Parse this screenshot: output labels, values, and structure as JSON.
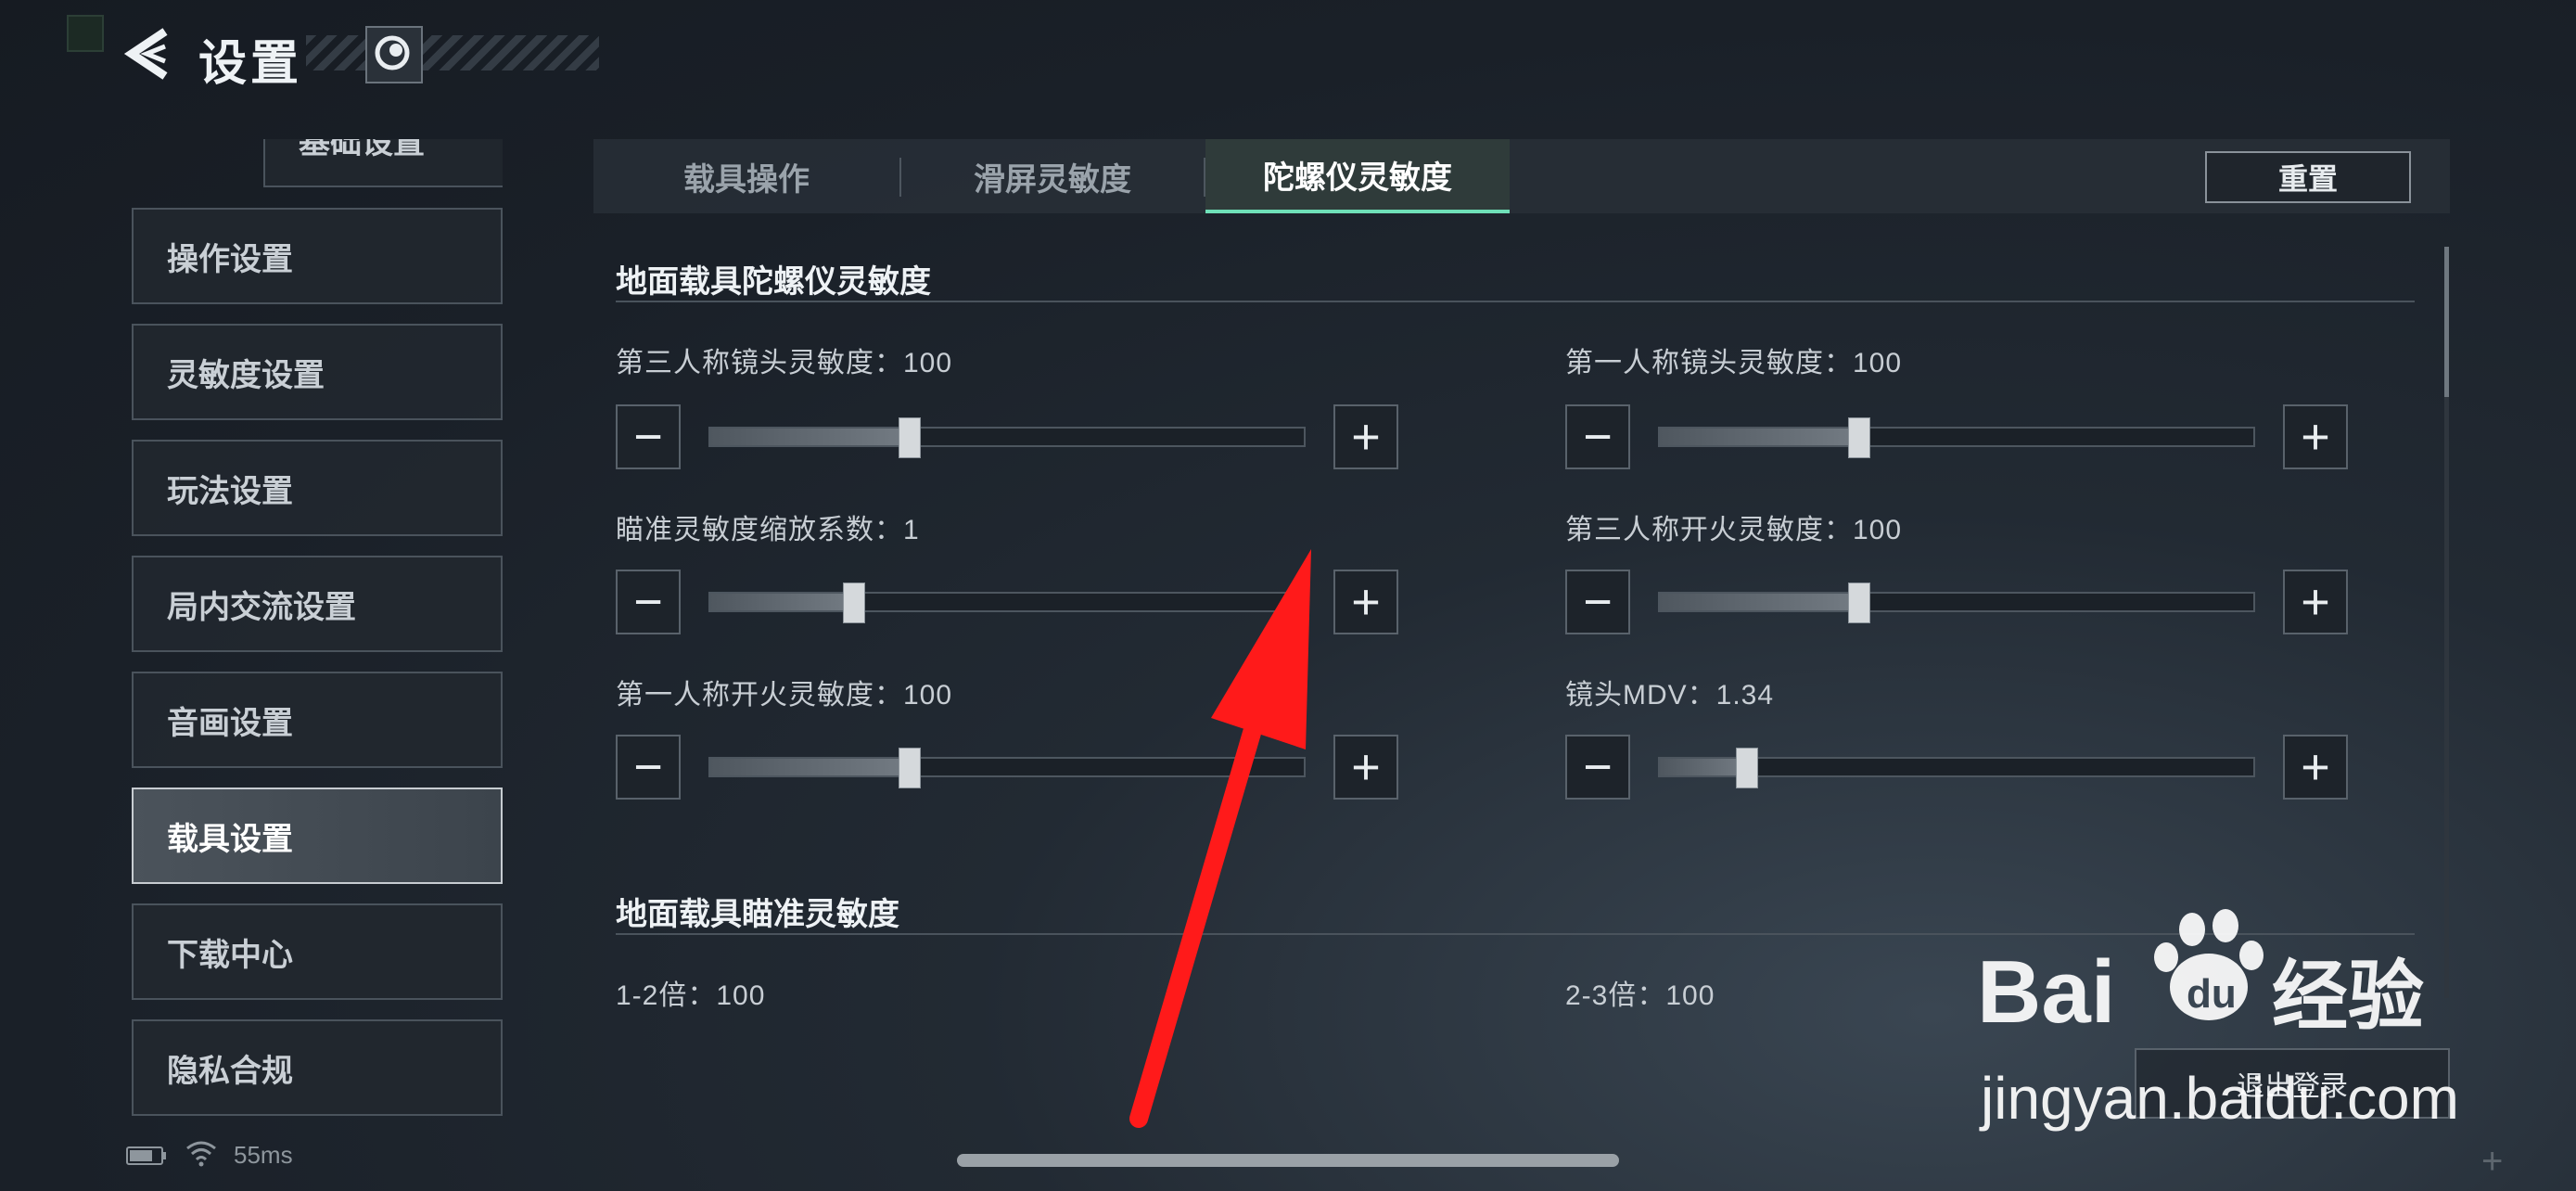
{
  "header": {
    "title": "设置",
    "back_icon": "back-arrow-icon",
    "avatar_icon": "avatar-icon"
  },
  "sidebar": {
    "items": [
      {
        "label": "基础设置",
        "active": false
      },
      {
        "label": "操作设置",
        "active": false
      },
      {
        "label": "灵敏度设置",
        "active": false
      },
      {
        "label": "玩法设置",
        "active": false
      },
      {
        "label": "局内交流设置",
        "active": false
      },
      {
        "label": "音画设置",
        "active": false
      },
      {
        "label": "载具设置",
        "active": true
      },
      {
        "label": "下载中心",
        "active": false
      },
      {
        "label": "隐私合规",
        "active": false
      }
    ]
  },
  "tabs": [
    {
      "label": "载具操作",
      "active": false
    },
    {
      "label": "滑屏灵敏度",
      "active": false
    },
    {
      "label": "陀螺仪灵敏度",
      "active": true
    }
  ],
  "reset_label": "重置",
  "sections": [
    {
      "title": "地面载具陀螺仪灵敏度",
      "settings": [
        {
          "label": "第三人称镜头灵敏度：100",
          "level": 0.335
        },
        {
          "label": "第一人称镜头灵敏度：100",
          "level": 0.335
        },
        {
          "label": "瞄准灵敏度缩放系数：1",
          "level": 0.24
        },
        {
          "label": "第三人称开火灵敏度：100",
          "level": 0.335
        },
        {
          "label": "第一人称开火灵敏度：100",
          "level": 0.335
        },
        {
          "label": "镜头MDV：1.34",
          "level": 0.145
        }
      ]
    },
    {
      "title": "地面载具瞄准灵敏度",
      "settings": [
        {
          "label": "1-2倍：100"
        },
        {
          "label": "2-3倍：100"
        }
      ]
    }
  ],
  "logout_label": "退出登录",
  "status": {
    "ping": "55ms",
    "battery_icon": "battery-icon",
    "wifi_icon": "wifi-icon"
  },
  "watermark": {
    "brand": "Bai du 经验",
    "url": "jingyan.baidu.com"
  },
  "colors": {
    "accent": "#6fe0b8",
    "arrow": "#ff1a1a",
    "background": "#1a2028"
  }
}
